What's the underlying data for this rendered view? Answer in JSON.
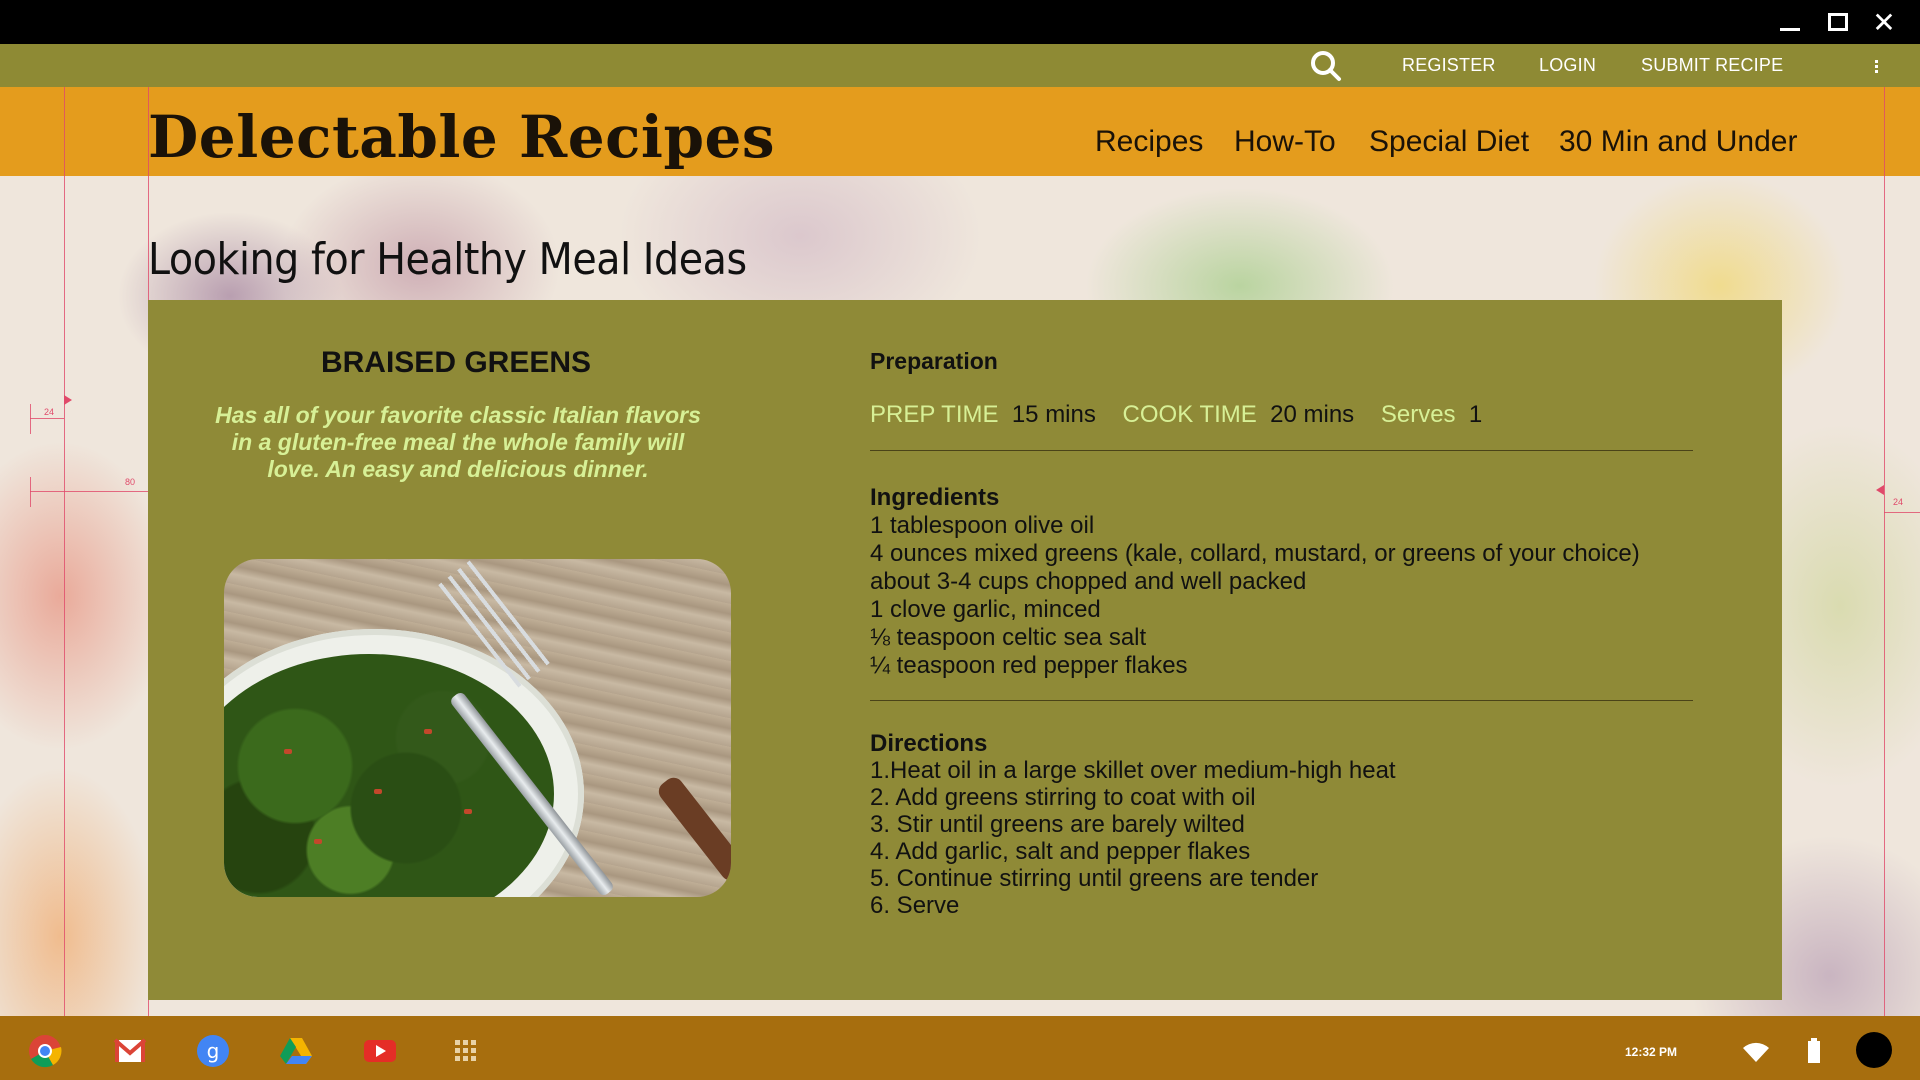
{
  "window": {
    "close_glyph": "✕"
  },
  "topbar": {
    "search_icon": "search-icon",
    "links": [
      "REGISTER",
      "LOGIN",
      "SUBMIT RECIPE"
    ],
    "menu_icon": "kebab-menu-icon"
  },
  "header": {
    "logo": "Delectable Recipes",
    "nav": [
      "Recipes",
      "How-To",
      "Special Diet",
      "30 Min and Under"
    ]
  },
  "page": {
    "heading": "Looking for Healthy Meal Ideas"
  },
  "recipe": {
    "title": "BRAISED GREENS",
    "description": "Has all of your favorite classic Italian flavors in a gluten-free meal the whole family will love. An easy and delicious dinner.",
    "preparation_title": "Preparation",
    "prep_time_label": "PREP TIME",
    "prep_time_value": "15 mins",
    "cook_time_label": "COOK TIME",
    "cook_time_value": "20 mins",
    "serves_label": "Serves",
    "serves_value": "1",
    "ingredients_title": "Ingredients",
    "ingredients": [
      "1 tablespoon olive oil",
      "4 ounces mixed greens (kale, collard, mustard, or greens of your choice)",
      "about 3-4 cups chopped and well packed",
      "1 clove garlic, minced",
      "⅛ teaspoon celtic sea salt",
      "¼ teaspoon red pepper flakes"
    ],
    "directions_title": "Directions",
    "directions": [
      "1.Heat oil in a large skillet over medium-high heat",
      "2. Add greens stirring to coat with oil",
      "3. Stir until greens are barely wilted",
      "4. Add garlic, salt and pepper flakes",
      "5. Continue stirring until greens are tender",
      "6. Serve"
    ]
  },
  "guides": {
    "left_top": "24",
    "left_mid": "80",
    "right": "24"
  },
  "taskbar": {
    "apps": [
      "chrome-icon",
      "gmail-icon",
      "google-search-icon",
      "drive-icon",
      "youtube-icon",
      "app-launcher-icon"
    ],
    "time": "12:32 PM"
  },
  "colors": {
    "topbar": "#8e8a34",
    "header": "#e49c1d",
    "card": "#8f8a37",
    "accent_text": "#d7f096",
    "taskbar": "#a76e0e"
  }
}
